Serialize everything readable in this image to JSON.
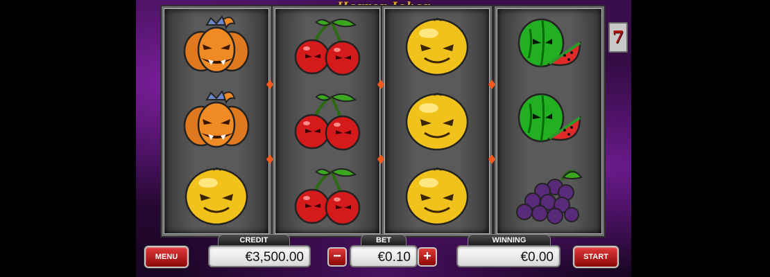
{
  "game": {
    "title": "Horror Joker",
    "seven_badge": "7"
  },
  "reels": [
    [
      "pumpkin-icon",
      "pumpkin-icon",
      "orange-icon"
    ],
    [
      "cherries-icon",
      "cherries-icon",
      "cherries-icon"
    ],
    [
      "orange-icon",
      "orange-icon",
      "orange-icon"
    ],
    [
      "watermelon-icon",
      "watermelon-icon",
      "grapes-icon"
    ]
  ],
  "controls": {
    "menu_label": "MENU",
    "credit_label": "CREDIT",
    "credit_value": "€3,500.00",
    "bet_label": "BET",
    "bet_value": "€0.10",
    "minus_label": "−",
    "plus_label": "+",
    "winning_label": "WINNING",
    "winning_value": "€0.00",
    "start_label": "START"
  },
  "colors": {
    "accent_red": "#c41414",
    "purple_background": "#5a1a7a",
    "title_gold": "#d9a640"
  }
}
